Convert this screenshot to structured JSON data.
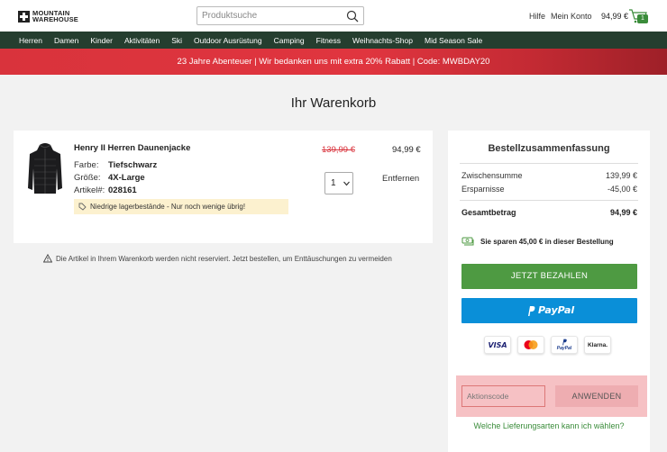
{
  "header": {
    "logo_line1": "MOUNTAIN",
    "logo_line2": "WAREHOUSE",
    "search_placeholder": "Produktsuche",
    "help_label": "Hilfe",
    "account_label": "Mein Konto",
    "cart_total": "94,99 €",
    "cart_count": "1"
  },
  "nav": {
    "items": [
      "Herren",
      "Damen",
      "Kinder",
      "Aktivitäten",
      "Ski",
      "Outdoor Ausrüstung",
      "Camping",
      "Fitness",
      "Weihnachts-Shop",
      "Mid Season Sale"
    ]
  },
  "promo": {
    "text": "23 Jahre Abenteuer | Wir bedanken uns mit extra 20% Rabatt | Code: MWBDAY20"
  },
  "page_title": "Ihr Warenkorb",
  "cart_item": {
    "name": "Henry II Herren Daunenjacke",
    "color_label": "Farbe:",
    "color_value": "Tiefschwarz",
    "size_label": "Größe:",
    "size_value": "4X-Large",
    "article_label": "Artikel#:",
    "article_value": "028161",
    "stock_note": "Niedrige lagerbestände - Nur noch wenige übrig!",
    "price_old": "139,99 €",
    "price_new": "94,99 €",
    "quantity": "1",
    "remove_label": "Entfernen"
  },
  "reserve_note": "Die Artikel in Ihrem Warenkorb werden nicht reserviert. Jetzt bestellen, um Enttäuschungen zu vermeiden",
  "summary": {
    "title": "Bestellzusammenfassung",
    "subtotal_label": "Zwischensumme",
    "subtotal_value": "139,99 €",
    "savings_label": "Ersparnisse",
    "savings_value": "-45,00 €",
    "total_label": "Gesamtbetrag",
    "total_value": "94,99 €",
    "savings_note": "Sie sparen 45,00 € in dieser Bestellung",
    "pay_button": "JETZT BEZAHLEN",
    "paypal_label": "PayPal",
    "badges": {
      "visa": "VISA",
      "paypal": "PayPal",
      "klarna": "Klarna."
    },
    "coupon_placeholder": "Aktionscode",
    "apply_button": "ANWENDEN",
    "delivery_link": "Welche Lieferungsarten kann ich wählen?"
  },
  "colors": {
    "nav_bg": "#253e2f",
    "promo_red": "#d9333c",
    "pay_green": "#4e9a42",
    "paypal_blue": "#0a8fd8",
    "link_green": "#3a8c3a"
  }
}
